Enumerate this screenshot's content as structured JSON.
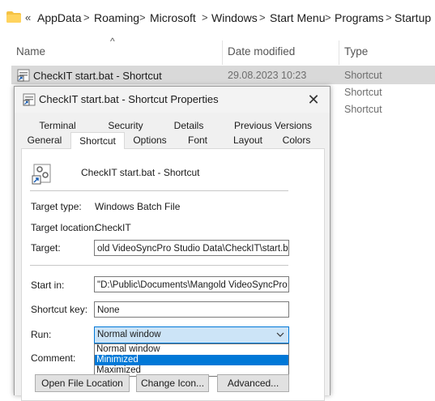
{
  "explorer": {
    "breadcrumb": [
      "AppData",
      "Roaming",
      "Microsoft",
      "Windows",
      "Start Menu",
      "Programs",
      "Startup"
    ],
    "columns": {
      "name": "Name",
      "date_modified": "Date modified",
      "type": "Type"
    },
    "rows": [
      {
        "name": "CheckIT start.bat - Shortcut",
        "date": "29.08.2023 10:23",
        "type": "Shortcut"
      },
      {
        "type": "Shortcut"
      },
      {
        "type": "Shortcut"
      }
    ]
  },
  "dialog": {
    "title": "CheckIT start.bat - Shortcut Properties",
    "tabs_row1": [
      "Terminal",
      "Security",
      "Details",
      "Previous Versions"
    ],
    "tabs_row2": [
      "General",
      "Shortcut",
      "Options",
      "Font",
      "Layout",
      "Colors"
    ],
    "active_tab": "Shortcut",
    "shortcut_name": "CheckIT start.bat - Shortcut",
    "target_type_label": "Target type:",
    "target_type_value": "Windows Batch File",
    "target_location_label": "Target location:",
    "target_location_value": "CheckIT",
    "target_label": "Target:",
    "target_value": "old VideoSyncPro Studio Data\\CheckIT\\start.bat\"",
    "start_in_label": "Start in:",
    "start_in_value": "\"D:\\Public\\Documents\\Mangold VideoSyncPro S",
    "shortcut_key_label": "Shortcut key:",
    "shortcut_key_value": "None",
    "run_label": "Run:",
    "run_selected": "Normal window",
    "run_options": [
      "Normal window",
      "Minimized",
      "Maximized"
    ],
    "run_highlighted": "Minimized",
    "comment_label": "Comment:",
    "buttons": {
      "open_file_location": "Open File Location",
      "change_icon": "Change Icon...",
      "advanced": "Advanced..."
    }
  }
}
